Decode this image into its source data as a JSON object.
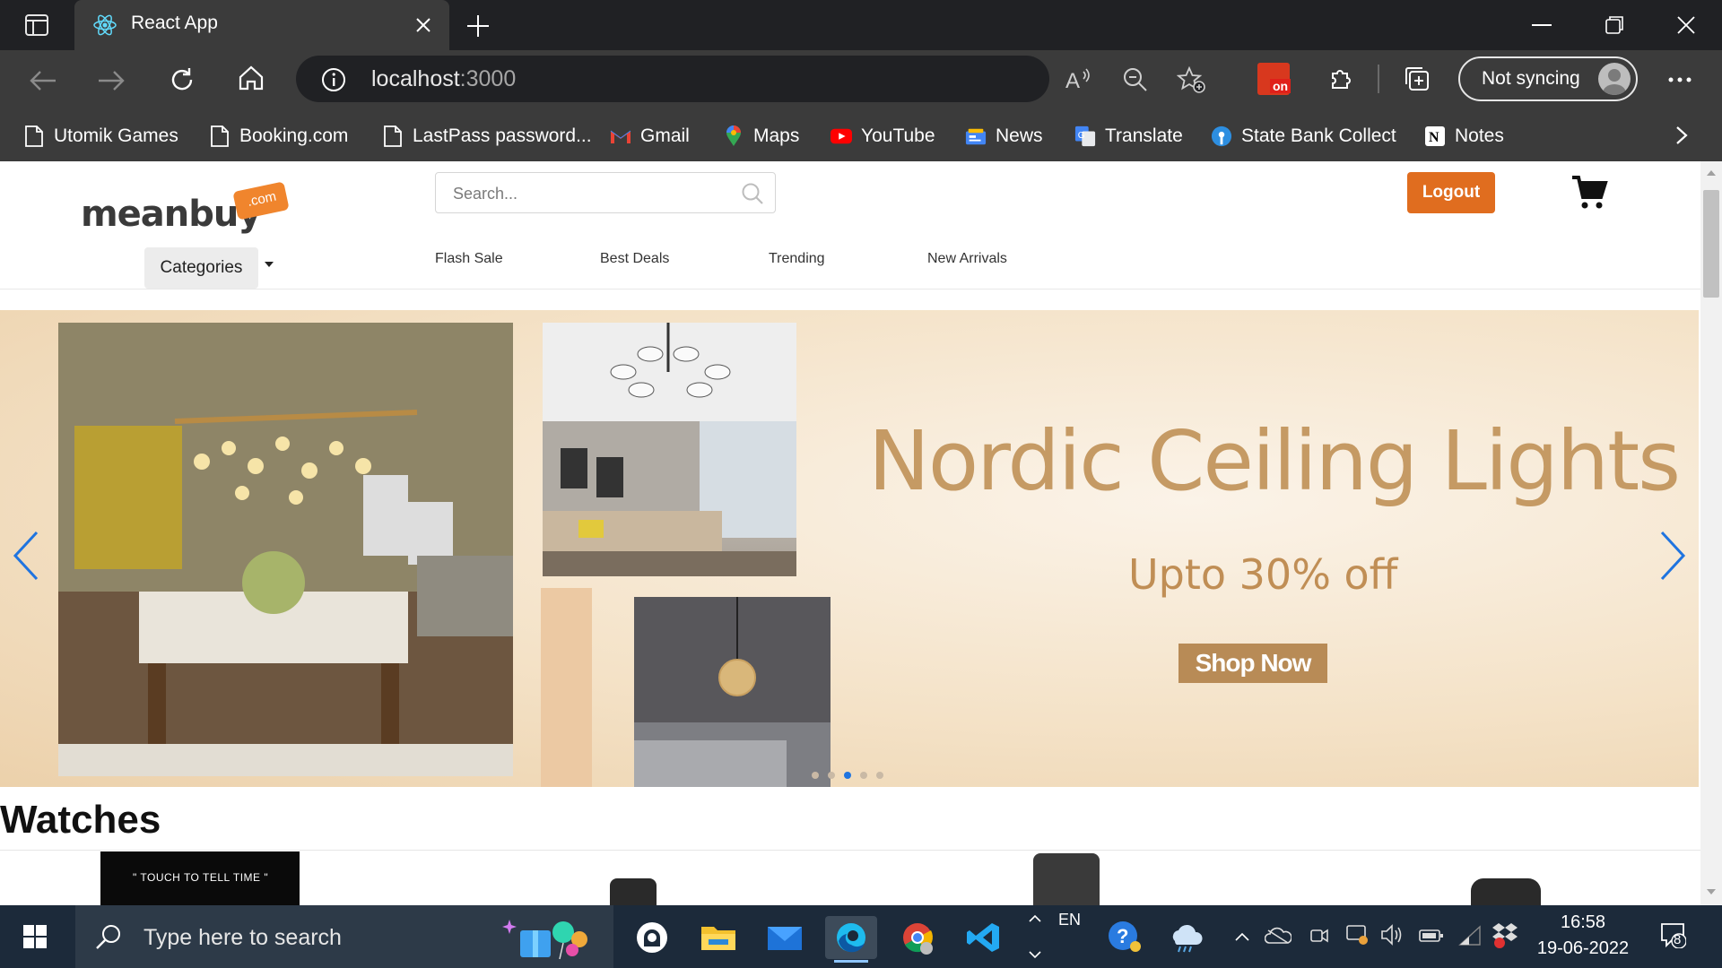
{
  "browser": {
    "tab_title": "React App",
    "address_host": "localhost",
    "address_port": ":3000",
    "sync_label": "Not syncing",
    "extension_badge": "on",
    "bookmarks": [
      {
        "label": "Utomik Games",
        "icon": "page-icon"
      },
      {
        "label": "Booking.com",
        "icon": "page-icon"
      },
      {
        "label": "LastPass password...",
        "icon": "page-icon"
      },
      {
        "label": "Gmail",
        "icon": "gmail-icon"
      },
      {
        "label": "Maps",
        "icon": "maps-icon"
      },
      {
        "label": "YouTube",
        "icon": "youtube-icon"
      },
      {
        "label": "News",
        "icon": "news-icon"
      },
      {
        "label": "Translate",
        "icon": "translate-icon"
      },
      {
        "label": "State Bank Collect",
        "icon": "sbi-icon"
      },
      {
        "label": "Notes",
        "icon": "notion-icon"
      }
    ]
  },
  "site": {
    "logo_text": "meanbuy",
    "logo_tag": ".com",
    "search_placeholder": "Search...",
    "logout_label": "Logout",
    "categories_label": "Categories",
    "nav": [
      "Flash Sale",
      "Best Deals",
      "Trending",
      "New Arrivals"
    ],
    "banner": {
      "headline": "Nordic Ceiling Lights",
      "subline": "Upto 30% off",
      "cta": "Shop Now",
      "slide_count": 5,
      "active_slide": 3
    },
    "section_title": "Watches",
    "promo_text": "\" TOUCH TO TELL TIME \""
  },
  "taskbar": {
    "search_placeholder": "Type here to search",
    "language": "EN",
    "time": "16:58",
    "date": "19-06-2022",
    "notifications": "8",
    "apps": [
      "github-desktop-icon",
      "file-explorer-icon",
      "mail-icon",
      "edge-icon",
      "chrome-icon",
      "vscode-icon"
    ]
  },
  "colors": {
    "accent_orange": "#e06d1f",
    "banner_gold": "#c59a64",
    "carousel_active": "#1f74e0"
  }
}
